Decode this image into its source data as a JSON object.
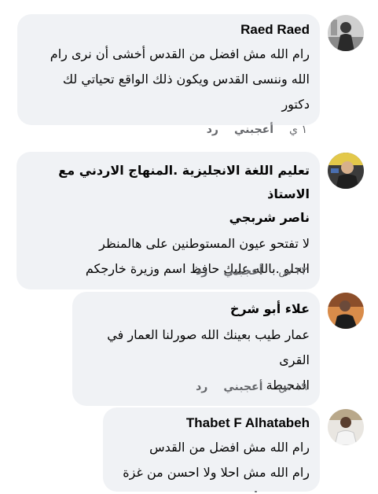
{
  "comments": [
    {
      "author": "Raed Raed",
      "lines": [
        "رام الله مش افضل من القدس أخشى أن نرى رام",
        "الله وننسى القدس ويكون ذلك الواقع تحياتي لك",
        "دكتور"
      ],
      "time": "١ ي",
      "like_label": "أعجبني",
      "reply_label": "رد"
    },
    {
      "author_lines": [
        "تعليم اللغة الانجليزية .المنهاج الاردني مع الاستاذ",
        "ناصر شربجي"
      ],
      "lines": [
        "لا تفتحو عيون المستوطنين على هالمنظر",
        "الحلو .بالله عليك حافظ اسم وزيرة خارجكم"
      ],
      "time": "٢٣ س",
      "like_label": "أعجبني",
      "reply_label": "رد"
    },
    {
      "author": "علاء أبو شرخ",
      "lines": [
        "عمار طيب بعينك الله صورلنا العمار في القرى",
        "المحيطة"
      ],
      "time": "١٩ س",
      "like_label": "أعجبني",
      "reply_label": "رد"
    },
    {
      "author": "Thabet F Alhatabeh",
      "lines": [
        "رام الله مش افضل من القدس",
        "رام الله مش احلا ولا احسن من غزة"
      ]
    }
  ],
  "colors": {
    "bubble_bg": "#f0f2f5",
    "meta_text": "#65676b",
    "body_text": "#050505"
  }
}
